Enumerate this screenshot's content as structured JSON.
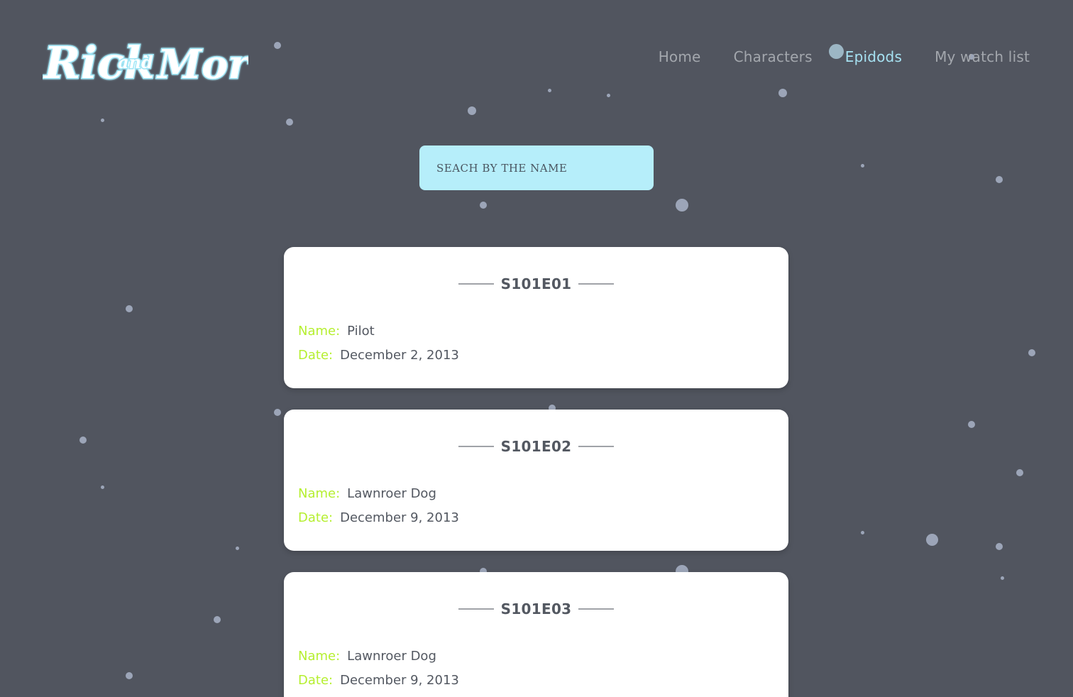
{
  "brand": {
    "logo_text_left": "Rick",
    "logo_text_mid": "and",
    "logo_text_right": "Morty",
    "logo_color": "#c8f3fb"
  },
  "nav": {
    "items": [
      {
        "label": "Home",
        "active": false
      },
      {
        "label": "Characters",
        "active": false
      },
      {
        "label": "Epidods",
        "active": true
      },
      {
        "label": "My watch list",
        "active": false
      }
    ]
  },
  "search": {
    "placeholder": "SEACH BY THE NAME"
  },
  "labels": {
    "name": "Name:",
    "date": "Date:"
  },
  "episodes": [
    {
      "code": "S101E01",
      "name": "Pilot",
      "date": "December 2, 2013"
    },
    {
      "code": "S101E02",
      "name": "Lawnroer Dog",
      "date": "December 9, 2013"
    },
    {
      "code": "S101E03",
      "name": "Lawnroer Dog",
      "date": "December 9, 2013"
    }
  ],
  "colors": {
    "background": "#51555f",
    "search_bg": "#b6eefa",
    "accent_label": "#b5ef2f",
    "nav_active": "#a6e2f2"
  }
}
